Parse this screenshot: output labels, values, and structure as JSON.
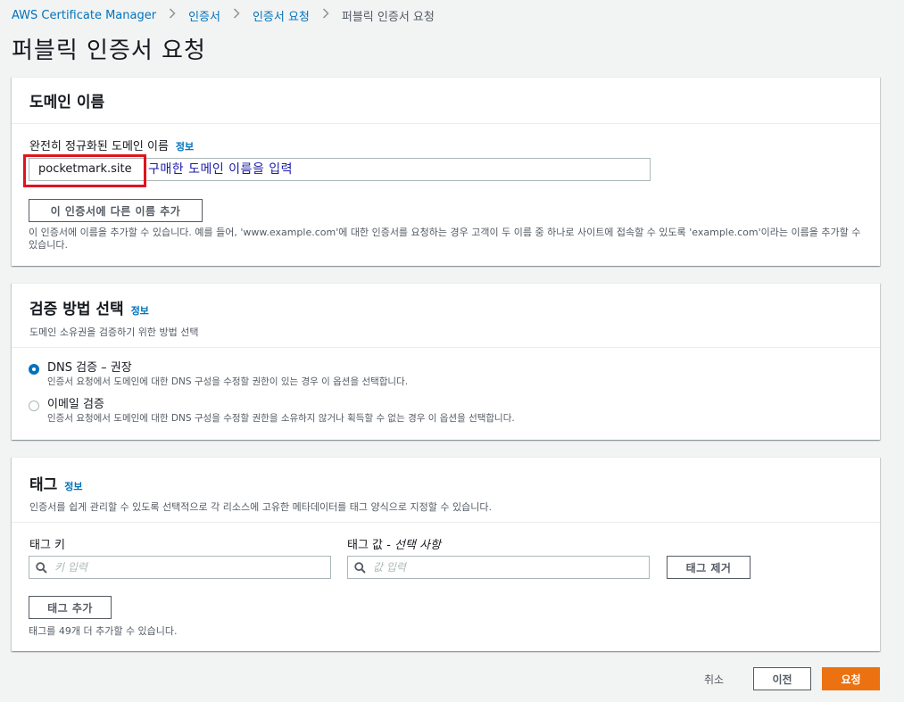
{
  "breadcrumb": {
    "items": [
      "AWS Certificate Manager",
      "인증서",
      "인증서 요청",
      "퍼블릭 인증서 요청"
    ]
  },
  "page_title": "퍼블릭 인증서 요청",
  "domain_panel": {
    "title": "도메인 이름",
    "field_label": "완전히 정규화된 도메인 이름",
    "info": "정보",
    "input_value": "pocketmark.site",
    "annotation": "구매한 도메인 이름을 입력",
    "add_name_button": "이 인증서에 다른 이름 추가",
    "help": "이 인증서에 이름을 추가할 수 있습니다. 예를 들어, 'www.example.com'에 대한 인증서를 요청하는 경우 고객이 두 이름 중 하나로 사이트에 접속할 수 있도록 'example.com'이라는 이름을 추가할 수 있습니다."
  },
  "validation_panel": {
    "title": "검증 방법 선택",
    "info": "정보",
    "description": "도메인 소유권을 검증하기 위한 방법 선택",
    "options": [
      {
        "label": "DNS 검증 – 권장",
        "desc": "인증서 요청에서 도메인에 대한 DNS 구성을 수정할 권한이 있는 경우 이 옵션을 선택합니다.",
        "checked": true
      },
      {
        "label": "이메일 검증",
        "desc": "인증서 요청에서 도메인에 대한 DNS 구성을 수정할 권한을 소유하지 않거나 획득할 수 없는 경우 이 옵션을 선택합니다.",
        "checked": false
      }
    ]
  },
  "tags_panel": {
    "title": "태그",
    "info": "정보",
    "description": "인증서를 쉽게 관리할 수 있도록 선택적으로 각 리소스에 고유한 메타데이터를 태그 양식으로 지정할 수 있습니다.",
    "key_label": "태그 키",
    "value_label_main": "태그 값 - ",
    "value_label_optional": "선택 사항",
    "key_placeholder": "키 입력",
    "value_placeholder": "값 입력",
    "remove_button": "태그 제거",
    "add_button": "태그 추가",
    "help": "태그를 49개 더 추가할 수 있습니다."
  },
  "footer": {
    "cancel": "취소",
    "previous": "이전",
    "submit": "요청"
  },
  "colors": {
    "link": "#0073bb",
    "primary": "#ec7211",
    "highlight": "#e0141e",
    "annotation": "#1a1aa6"
  }
}
